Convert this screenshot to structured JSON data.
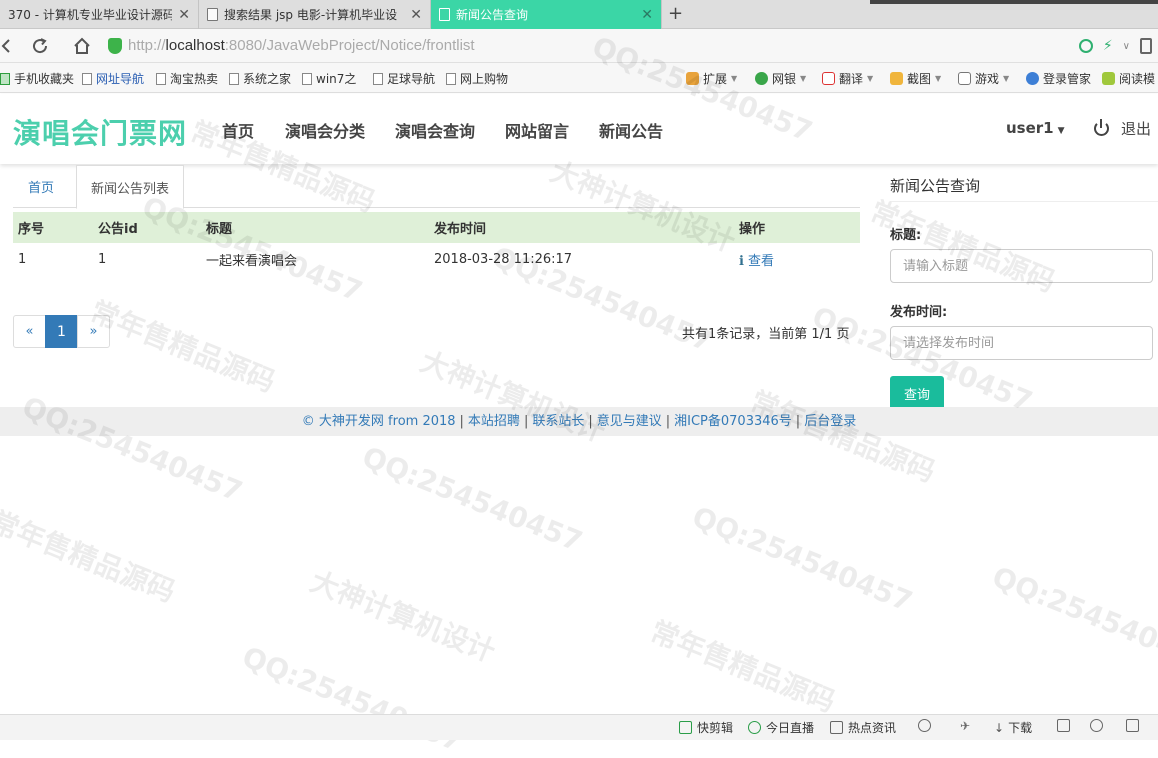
{
  "browser": {
    "tabs": [
      {
        "title": "370 - 计算机专业毕业设计源码",
        "active": false
      },
      {
        "title": "搜索结果 jsp 电影-计算机毕业设",
        "active": false
      },
      {
        "title": "新闻公告查询",
        "active": true
      }
    ],
    "new_tab": "+",
    "close_glyph": "✕",
    "url_prefix": "http://",
    "url_host": "localhost",
    "url_rest": ":8080/JavaWebProject/Notice/frontlist",
    "bookmarks": [
      "手机收藏夹",
      "网址导航",
      "淘宝热卖",
      "系统之家",
      "win7之",
      "足球导航",
      "网上购物"
    ],
    "extensions": [
      "扩展",
      "网银",
      "翻译",
      "截图",
      "游戏",
      "登录管家",
      "阅读模"
    ]
  },
  "site": {
    "brand": "演唱会门票网",
    "nav": [
      "首页",
      "演唱会分类",
      "演唱会查询",
      "网站留言",
      "新闻公告"
    ],
    "user": "user1",
    "logout": "退出"
  },
  "breadcrumb": {
    "home": "首页",
    "current": "新闻公告列表"
  },
  "table": {
    "headers": [
      "序号",
      "公告id",
      "标题",
      "发布时间",
      "操作"
    ],
    "rows": [
      {
        "index": "1",
        "id": "1",
        "title": "一起来看演唱会",
        "time": "2018-03-28 11:26:17",
        "action": "查看"
      }
    ]
  },
  "pagination": {
    "prev": "«",
    "current": "1",
    "next": "»",
    "summary": "共有1条记录，当前第 1/1 页"
  },
  "search": {
    "title": "新闻公告查询",
    "title_label": "标题:",
    "title_placeholder": "请输入标题",
    "time_label": "发布时间:",
    "time_placeholder": "请选择发布时间",
    "button": "查询"
  },
  "footer": {
    "copyright": "© 大神开发网 from 2018",
    "links": [
      "本站招聘",
      "联系站长",
      "意见与建议",
      "湘ICP备0703346号",
      "后台登录"
    ]
  },
  "watermark": [
    "QQ:254540457",
    "大神计算机设计",
    "常年售精品源码"
  ],
  "statusbar": [
    "快剪辑",
    "今日直播",
    "热点资讯",
    "下载"
  ],
  "colors": {
    "brand": "#4ccfad",
    "active_tab": "#3bd6a6",
    "table_header": "#dff0d8",
    "link": "#337ab7",
    "query_button": "#1abc9c"
  }
}
